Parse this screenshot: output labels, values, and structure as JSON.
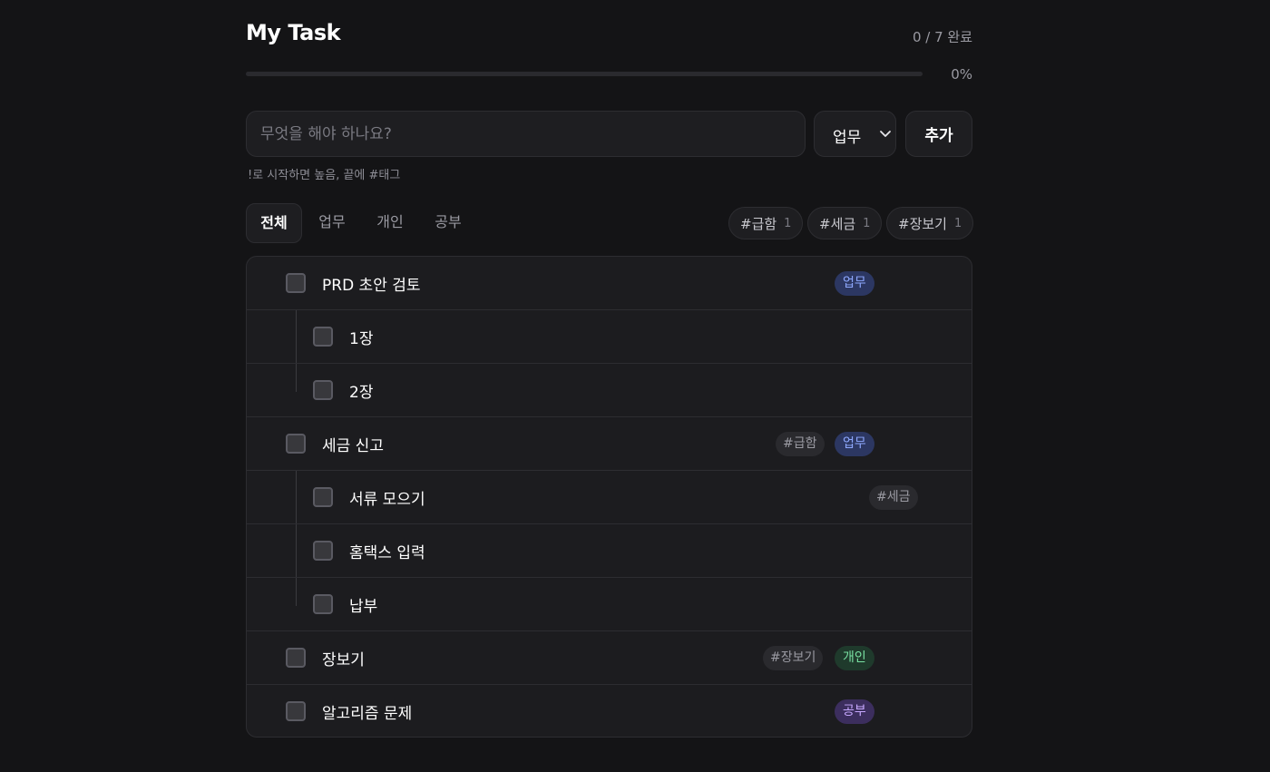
{
  "header": {
    "title": "My Task",
    "count_text": "0 / 7 완료",
    "progress_text": "0%",
    "progress_value": 0
  },
  "composer": {
    "placeholder": "무엇을 해야 하나요?",
    "category_value": "업무",
    "add_label": "추가",
    "hint": "!로 시작하면 높음, 끝에 #태그"
  },
  "tabs": [
    {
      "label": "전체",
      "active": true
    },
    {
      "label": "업무",
      "active": false
    },
    {
      "label": "개인",
      "active": false
    },
    {
      "label": "공부",
      "active": false
    }
  ],
  "tag_filters": [
    {
      "label": "#급함",
      "count": "1"
    },
    {
      "label": "#세금",
      "count": "1"
    },
    {
      "label": "#장보기",
      "count": "1"
    }
  ],
  "tasks": [
    {
      "label": "PRD 초안 검토",
      "category": "업무"
    },
    {
      "label": "1장"
    },
    {
      "label": "2장"
    },
    {
      "label": "세금 신고",
      "tag": "#급함",
      "category": "업무"
    },
    {
      "label": "서류 모으기",
      "tag": "#세금"
    },
    {
      "label": "홈택스 입력"
    },
    {
      "label": "납부"
    },
    {
      "label": "장보기",
      "tag": "#장보기",
      "category": "개인"
    },
    {
      "label": "알고리즘 문제",
      "category": "공부"
    }
  ],
  "colors": {
    "background": "#141416",
    "accent": "#6d8df0",
    "work": "#8ea8ff",
    "personal": "#78e0a2",
    "study": "#c7a8ff"
  }
}
